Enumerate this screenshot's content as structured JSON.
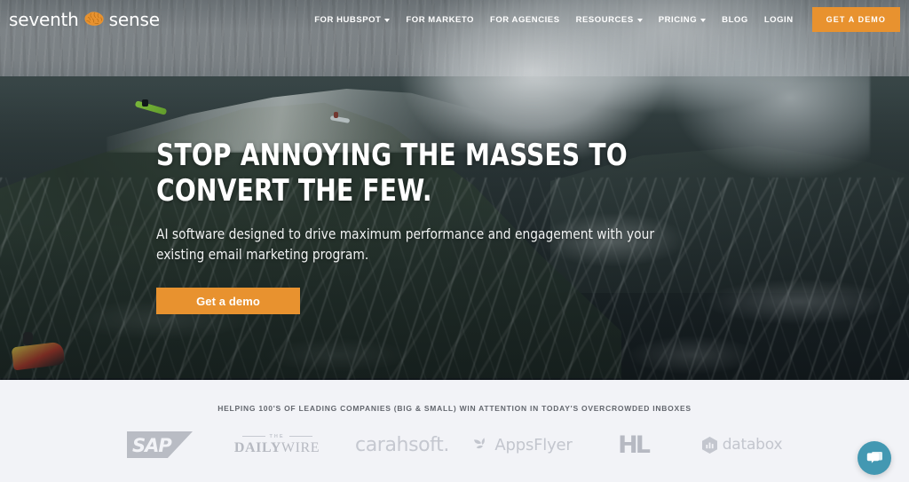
{
  "header": {
    "logo": {
      "word1": "seventh",
      "word2": "sense",
      "icon": "brain-icon"
    },
    "nav": [
      {
        "label": "FOR HUBSPOT",
        "has_dropdown": true
      },
      {
        "label": "FOR MARKETO",
        "has_dropdown": false
      },
      {
        "label": "FOR AGENCIES",
        "has_dropdown": false
      },
      {
        "label": "RESOURCES",
        "has_dropdown": true
      },
      {
        "label": "PRICING",
        "has_dropdown": true
      },
      {
        "label": "BLOG",
        "has_dropdown": false
      },
      {
        "label": "LOGIN",
        "has_dropdown": false
      }
    ],
    "demo_button": "GET A DEMO",
    "accent_color": "#e8922f"
  },
  "hero": {
    "headline": "STOP ANNOYING THE MASSES TO CONVERT THE FEW.",
    "subheadline": "AI software designed to drive maximum performance and engagement with your existing email marketing program.",
    "cta_label": "Get a demo",
    "background": "big-wave-surfing-photo"
  },
  "social_proof": {
    "title": "HELPING 100'S OF LEADING COMPANIES (BIG & SMALL) WIN ATTENTION IN TODAY'S OVERCROWDED INBOXES",
    "logos": [
      {
        "name": "SAP",
        "text": "SAP"
      },
      {
        "name": "The Daily Wire",
        "the": "THE",
        "daily": "DAILY",
        "wire": "WIRE"
      },
      {
        "name": "Carahsoft",
        "text": "carahsoft."
      },
      {
        "name": "AppsFlyer",
        "text": "AppsFlyer"
      },
      {
        "name": "HL",
        "text": "HL"
      },
      {
        "name": "Databox",
        "text": "databox"
      }
    ],
    "background_color": "#f2f3f7"
  },
  "chat_widget": {
    "name": "chat-bubble",
    "color": "#4398b2"
  }
}
